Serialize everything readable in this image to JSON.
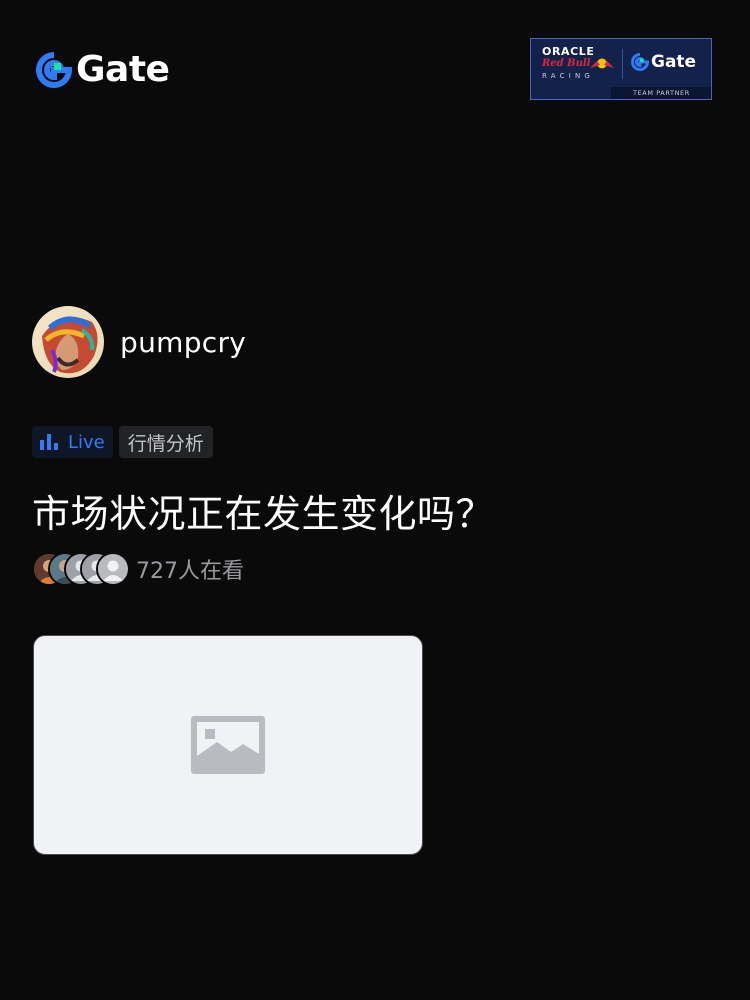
{
  "header": {
    "logo_text": "Gate",
    "partner": {
      "oracle": "ORACLE",
      "red_bull": "Red Bull",
      "racing": "RACING",
      "gate": "Gate",
      "team_partner": "TEAM PARTNER"
    }
  },
  "author": {
    "username": "pumpcry"
  },
  "tags": {
    "live_label": "Live",
    "category": "行情分析"
  },
  "post": {
    "title": "市场状况正在发生变化吗？",
    "viewers": "727人在看"
  },
  "colors": {
    "background": "#0a0a0b",
    "brand_blue": "#2f7cf6",
    "brand_green": "#17e6a1",
    "text_primary": "#ffffff",
    "text_secondary": "#9a9ba0"
  },
  "icons": {
    "live": "bar-chart-icon",
    "image_placeholder": "image-placeholder-icon"
  }
}
